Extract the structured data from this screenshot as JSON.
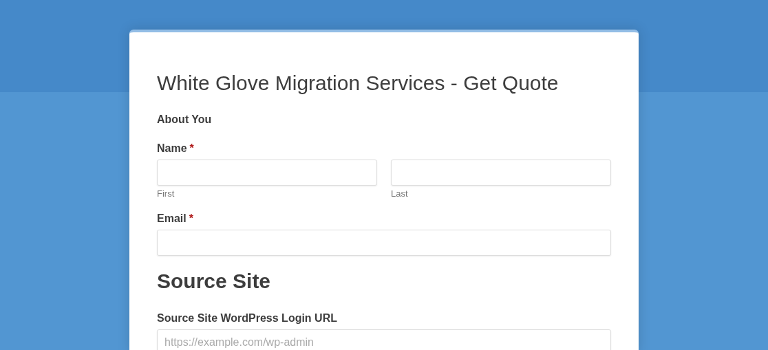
{
  "form": {
    "title": "White Glove Migration Services - Get Quote",
    "items": [
      {
        "kind": "subheading",
        "text": "About You"
      },
      {
        "kind": "name",
        "label": "Name",
        "required_mark": "*",
        "parts": [
          {
            "sublabel": "First"
          },
          {
            "sublabel": "Last"
          }
        ]
      },
      {
        "kind": "text",
        "label": "Email",
        "required_mark": "*"
      },
      {
        "kind": "heading",
        "text": "Source Site"
      },
      {
        "kind": "text",
        "label": "Source Site WordPress Login URL",
        "placeholder": "https://example.com/wp-admin"
      }
    ]
  }
}
